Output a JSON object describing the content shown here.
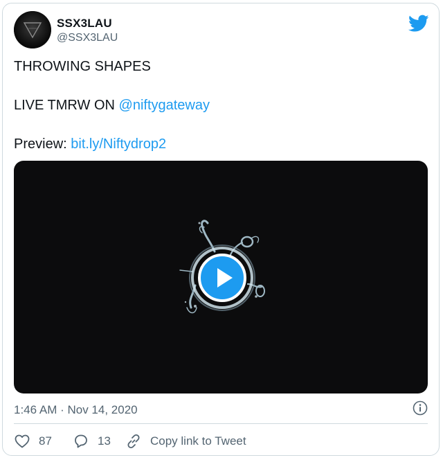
{
  "author": {
    "display_name": "SSX3LAU",
    "handle": "@SSX3LAU",
    "avatar_icon": "inverted-triangle-logo"
  },
  "brand_icon": "twitter-bird-icon",
  "tweet": {
    "line1": "THROWING SHAPES",
    "line2_prefix": "LIVE TMRW ON ",
    "line2_mention": "@niftygateway",
    "line3_prefix": "Preview: ",
    "line3_link": "bit.ly/Niftydrop2"
  },
  "media": {
    "type": "video",
    "play_icon": "play-icon"
  },
  "meta": {
    "timestamp": "1:46 AM · Nov 14, 2020",
    "info_icon": "info-icon"
  },
  "actions": {
    "likes": "87",
    "replies": "13",
    "copy_link": "Copy link to Tweet"
  },
  "colors": {
    "accent": "#1d9bf0",
    "text": "#0f1419",
    "muted": "#536471",
    "border": "#cfd9de",
    "media_bg": "#0c0c0d"
  }
}
